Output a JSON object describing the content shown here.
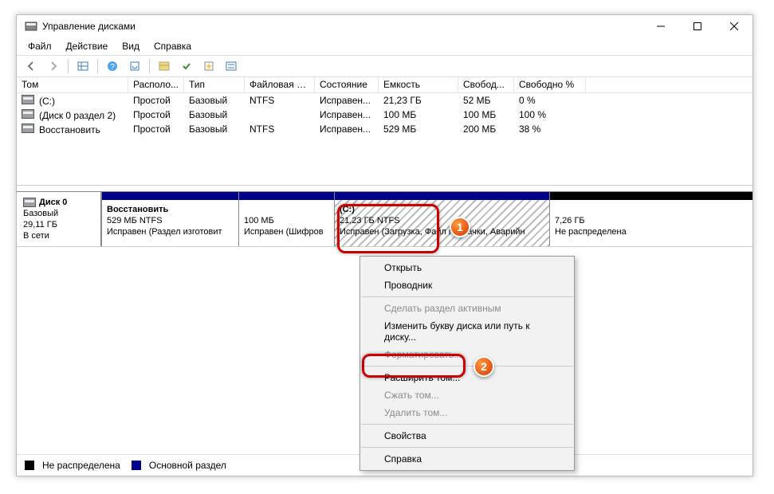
{
  "window": {
    "title": "Управление дисками"
  },
  "winbtn": {
    "min": "−",
    "max": "☐",
    "close": "✕"
  },
  "menu": {
    "file": "Файл",
    "action": "Действие",
    "view": "Вид",
    "help": "Справка"
  },
  "col": {
    "vol": "Том",
    "layout": "Располо...",
    "type": "Тип",
    "fs": "Файловая с...",
    "status": "Состояние",
    "capacity": "Емкость",
    "free": "Свобод...",
    "pct": "Свободно %"
  },
  "rows": [
    {
      "vol": "(C:)",
      "layout": "Простой",
      "type": "Базовый",
      "fs": "NTFS",
      "status": "Исправен...",
      "cap": "21,23 ГБ",
      "free": "52 МБ",
      "pct": "0 %"
    },
    {
      "vol": "(Диск 0 раздел 2)",
      "layout": "Простой",
      "type": "Базовый",
      "fs": "",
      "status": "Исправен...",
      "cap": "100 МБ",
      "free": "100 МБ",
      "pct": "100 %"
    },
    {
      "vol": "Восстановить",
      "layout": "Простой",
      "type": "Базовый",
      "fs": "NTFS",
      "status": "Исправен...",
      "cap": "529 МБ",
      "free": "200 МБ",
      "pct": "38 %"
    }
  ],
  "disk": {
    "name": "Диск 0",
    "type": "Базовый",
    "size": "29,11 ГБ",
    "state": "В сети"
  },
  "parts": {
    "p0": {
      "name": "Восстановить",
      "size": "529 МБ NTFS",
      "stat": "Исправен (Раздел изготовит"
    },
    "p1": {
      "size": "100 МБ",
      "stat": "Исправен (Шифров"
    },
    "p2": {
      "name": "(C:)",
      "size": "21,23 ГБ NTFS",
      "stat": "Исправен (Загрузка, Файл подкачки, Аварийн"
    },
    "p3": {
      "size": "7,26 ГБ",
      "stat": "Не распределена"
    }
  },
  "legend": {
    "unalloc": "Не распределена",
    "primary": "Основной раздел"
  },
  "ctx": {
    "open": "Открыть",
    "explorer": "Проводник",
    "active": "Сделать раздел активным",
    "change": "Изменить букву диска или путь к диску...",
    "format": "Форматировать...",
    "extend": "Расширить том...",
    "shrink": "Сжать том...",
    "delete": "Удалить том...",
    "props": "Свойства",
    "help": "Справка"
  },
  "callouts": {
    "one": "1",
    "two": "2"
  }
}
